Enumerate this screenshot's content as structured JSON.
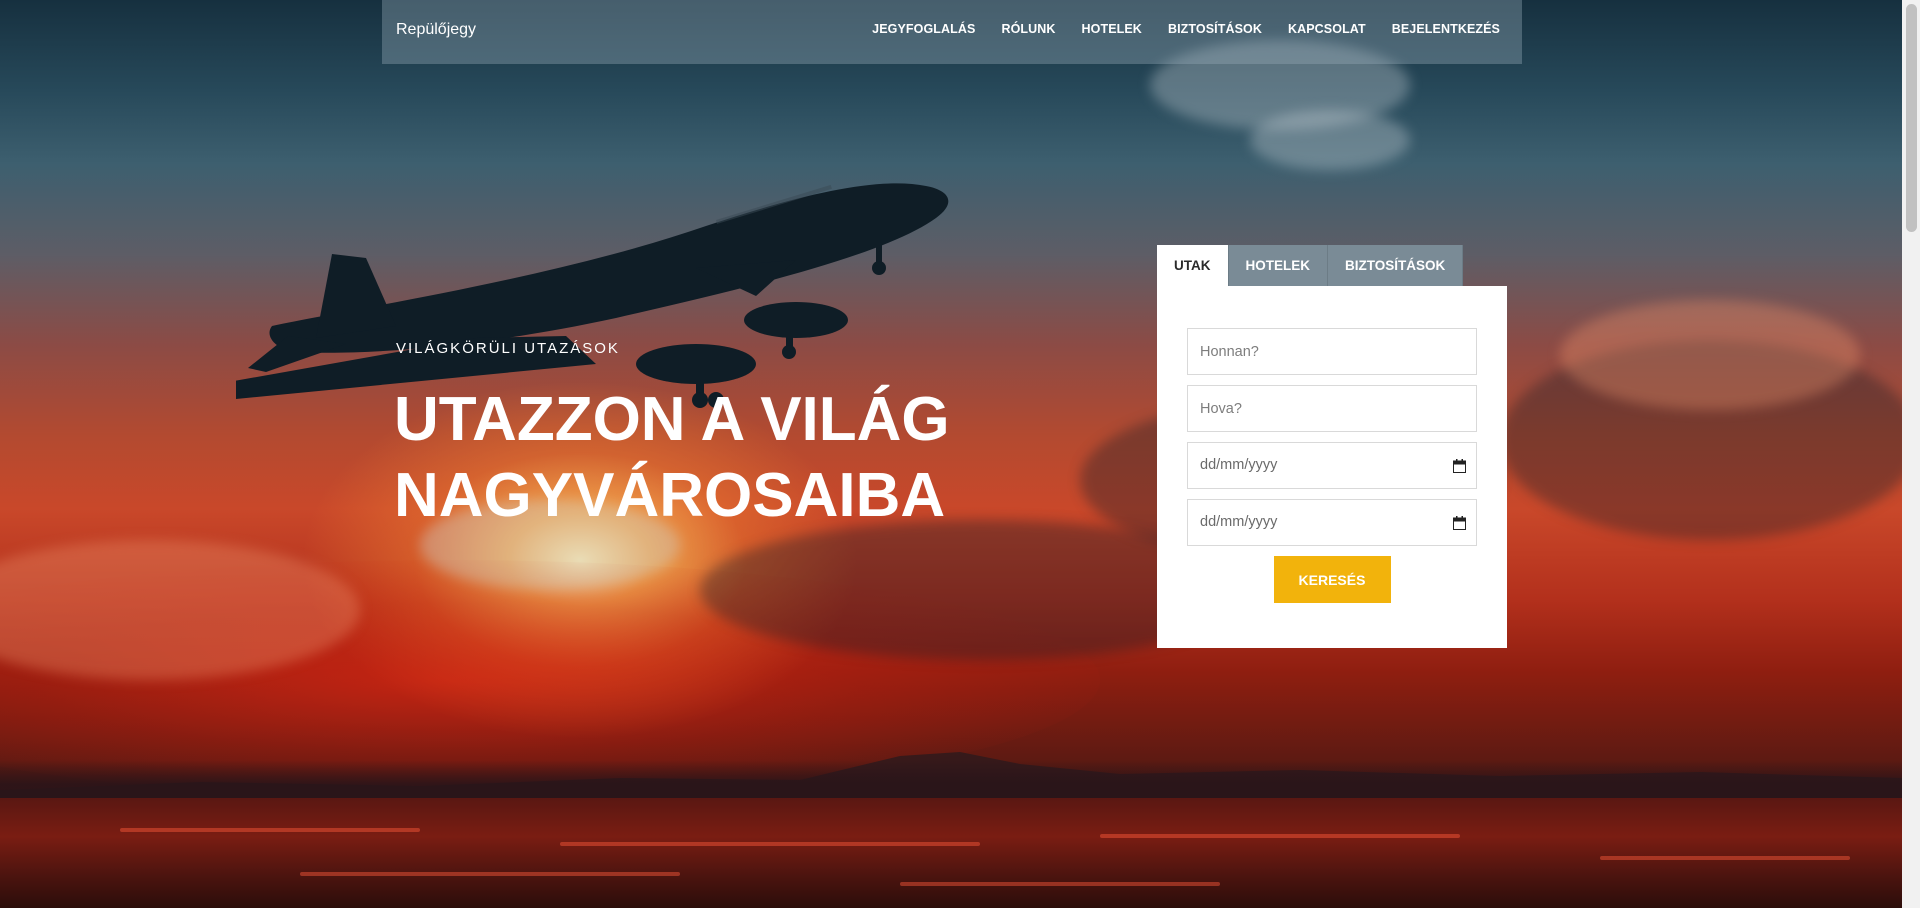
{
  "nav": {
    "brand": "Repülőjegy",
    "links": [
      "JEGYFOGLALÁS",
      "RÓLUNK",
      "HOTELEK",
      "BIZTOSÍTÁSOK",
      "KAPCSOLAT",
      "BEJELENTKEZÉS"
    ]
  },
  "hero": {
    "subtitle": "VILÁGKÖRÜLI UTAZÁSOK",
    "headline_line1": "UTAZZON A VILÁG",
    "headline_line2": "NAGYVÁROSAIBA"
  },
  "booking": {
    "tabs": [
      "UTAK",
      "HOTELEK",
      "BIZTOSÍTÁSOK"
    ],
    "active_tab": "UTAK",
    "from_placeholder": "Honnan?",
    "to_placeholder": "Hova?",
    "date1_placeholder": "dd/mm/yyyy",
    "date2_placeholder": "dd/mm/yyyy",
    "search_label": "KERESÉS"
  },
  "colors": {
    "accent": "#f2b30c",
    "tab_inactive": "#7a8b96",
    "navbar_overlay": "rgba(150,170,185,0.38)"
  },
  "icons": {
    "date_picker": "calendar-icon"
  }
}
